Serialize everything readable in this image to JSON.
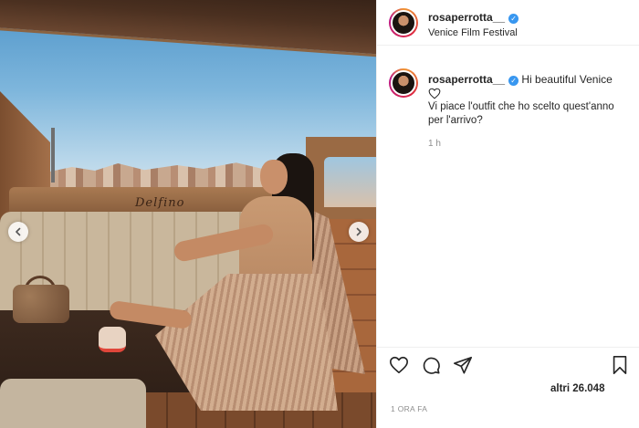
{
  "post": {
    "username": "rosaperrotta__",
    "verified": true,
    "location": "Venice Film Festival",
    "photo_brand_text": "Delfino"
  },
  "caption": {
    "username": "rosaperrotta__",
    "first_line": "Hi beautiful Venice",
    "body": "Vi piace l'outfit che ho scelto quest'anno per l'arrivo?",
    "time_ago": "1 h"
  },
  "actions": {
    "like_icon": "heart-outline-icon",
    "comment_icon": "comment-icon",
    "share_icon": "send-icon",
    "save_icon": "bookmark-icon"
  },
  "likes_text": "altri 26.048",
  "posted_time": "1 ORA FA",
  "carousel": {
    "prev_icon": "chevron-left-icon",
    "next_icon": "chevron-right-icon"
  },
  "colors": {
    "verified": "#3897f0",
    "muted_text": "#8e8e8e",
    "divider": "#efefef"
  }
}
